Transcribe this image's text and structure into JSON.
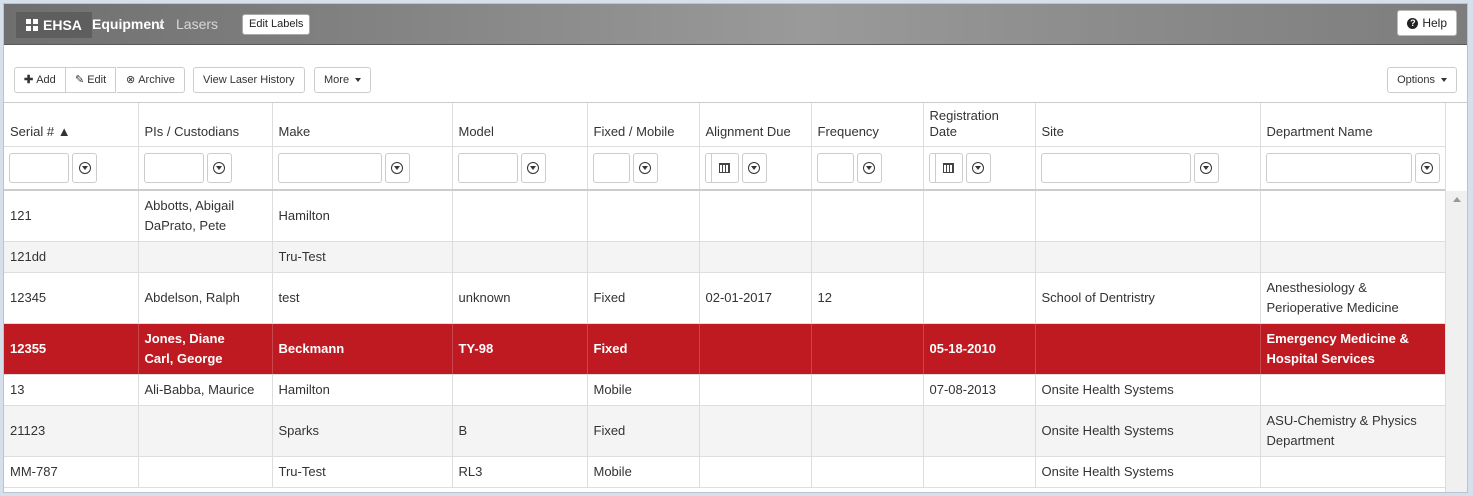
{
  "header": {
    "brand": "EHSA",
    "breadcrumb": [
      "Equipment",
      "/",
      "Lasers"
    ],
    "edit_labels": "Edit Labels",
    "help": "Help"
  },
  "toolbar": {
    "add": "Add",
    "edit": "Edit",
    "archive": "Archive",
    "view_history": "View Laser History",
    "more": "More",
    "options": "Options"
  },
  "columns": [
    "Serial # ▲",
    "PIs / Custodians",
    "Make",
    "Model",
    "Fixed / Mobile",
    "Alignment Due",
    "Frequency",
    "Registration Date",
    "Site",
    "Department Name"
  ],
  "rows": [
    {
      "serial": "121",
      "pis": [
        "Abbotts, Abigail",
        "DaPrato, Pete"
      ],
      "make": "Hamilton",
      "model": "",
      "fixed": "",
      "align": "",
      "freq": "",
      "reg": "",
      "site": "",
      "dept": ""
    },
    {
      "serial": "121dd",
      "pis": [],
      "make": "Tru-Test",
      "model": "",
      "fixed": "",
      "align": "",
      "freq": "",
      "reg": "",
      "site": "",
      "dept": ""
    },
    {
      "serial": "12345",
      "pis": [
        "Abdelson, Ralph"
      ],
      "make": "test",
      "model": "unknown",
      "fixed": "Fixed",
      "align": "02-01-2017",
      "freq": "12",
      "reg": "",
      "site": "School of Dentristry",
      "dept": "Anesthesiology & Perioperative Medicine"
    },
    {
      "serial": "12355",
      "pis": [
        "Jones, Diane",
        "Carl, George"
      ],
      "make": "Beckmann",
      "model": "TY-98",
      "fixed": "Fixed",
      "align": "",
      "freq": "",
      "reg": "05-18-2010",
      "site": "",
      "dept": "Emergency Medicine & Hospital Services"
    },
    {
      "serial": "13",
      "pis": [
        "Ali-Babba, Maurice"
      ],
      "make": "Hamilton",
      "model": "",
      "fixed": "Mobile",
      "align": "",
      "freq": "",
      "reg": "07-08-2013",
      "site": "Onsite Health Systems",
      "dept": ""
    },
    {
      "serial": "21123",
      "pis": [],
      "make": "Sparks",
      "model": "B",
      "fixed": "Fixed",
      "align": "",
      "freq": "",
      "reg": "",
      "site": "Onsite Health Systems",
      "dept": "ASU-Chemistry & Physics Department"
    },
    {
      "serial": "MM-787",
      "pis": [],
      "make": "Tru-Test",
      "model": "RL3",
      "fixed": "Mobile",
      "align": "",
      "freq": "",
      "reg": "",
      "site": "Onsite Health Systems",
      "dept": ""
    }
  ]
}
